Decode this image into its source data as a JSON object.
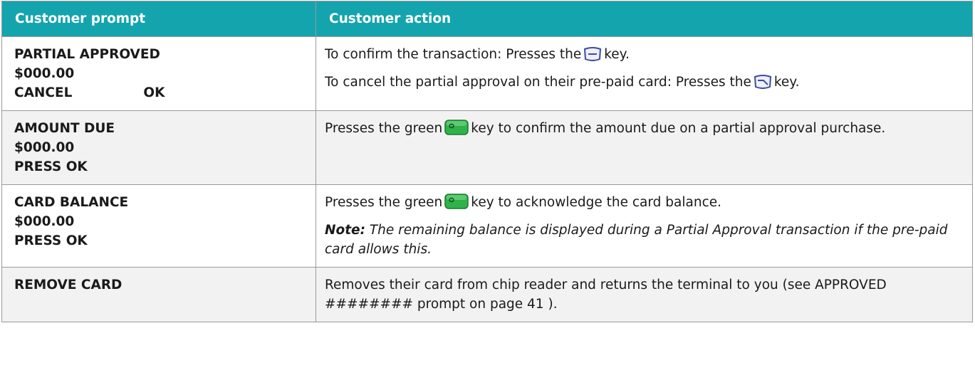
{
  "table": {
    "headers": {
      "prompt": "Customer prompt",
      "action": "Customer action"
    },
    "rows": [
      {
        "prompt": {
          "line1": "PARTIAL APPROVED",
          "line2": "$000.00",
          "cancel": "CANCEL",
          "ok": "OK"
        },
        "action": {
          "p1_before": "To confirm the transaction: Presses the",
          "p1_icon": "right-softkey-icon",
          "p1_after": "key.",
          "p2_before": "To cancel the partial approval on their pre-paid card: Presses the",
          "p2_icon": "left-softkey-icon",
          "p2_after": "key."
        }
      },
      {
        "prompt": {
          "line1": "AMOUNT DUE",
          "line2": "$000.00",
          "line3": "PRESS OK"
        },
        "action": {
          "before": "Presses the green",
          "icon": "green-ok-key-icon",
          "after": "key to confirm the amount due on a partial approval purchase."
        }
      },
      {
        "prompt": {
          "line1": "CARD BALANCE",
          "line2": "$000.00",
          "line3": "PRESS OK"
        },
        "action": {
          "before": "Presses the green",
          "icon": "green-ok-key-icon",
          "after": "key to acknowledge the card balance.",
          "note_label": "Note:",
          "note_text": "The remaining balance is displayed during a Partial Approval transaction if the pre-paid card allows this."
        }
      },
      {
        "prompt": {
          "line1": "REMOVE CARD"
        },
        "action": {
          "text": "Removes their card from chip reader and returns the terminal to you (see APPROVED ######## prompt on page 41 )."
        }
      }
    ],
    "colors": {
      "header_bg": "#14a4ae",
      "alt_row_bg": "#f2f2f2",
      "key_green": "#2fb24a"
    }
  }
}
